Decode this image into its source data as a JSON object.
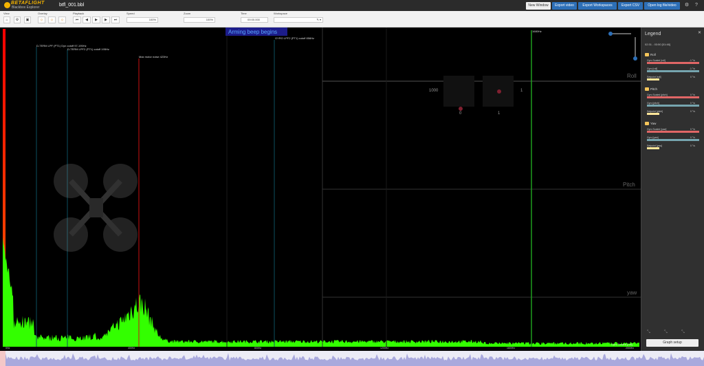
{
  "app": {
    "brand": "BETAFLIGHT",
    "subtitle": "Blackbox Explorer",
    "filename": "btfl_001.bbl"
  },
  "top_buttons": [
    "New Window",
    "Export video",
    "Export Workspaces",
    "Export CSV",
    "Open log file/video"
  ],
  "toolbar": {
    "view_label": "View",
    "overlay_label": "Overlay",
    "playback_label": "Playback",
    "speed_label": "Speed",
    "speed_value": "100%",
    "zoom_label": "Zoom",
    "zoom_value": "100%",
    "time_label": "Time",
    "time_value": "00:00.000",
    "workspace_label": "Workspace"
  },
  "graph": {
    "arming_banner": "Arming beep begins",
    "annotations": [
      "D-TERM LPF (PT1) Dyn cutoff 97-195Hz",
      "D-TERM LPF2 (PT1) cutoff 195Hz",
      "Max motor noise 423Hz",
      "GYRO LPF2 (PT1) cutoff 856Hz",
      "1680Hz"
    ],
    "x_ticks": [
      "0Hz",
      "400Hz",
      "800Hz",
      "1200Hz",
      "1600Hz",
      "2000Hz"
    ],
    "axis_names": [
      "Roll",
      "Pitch",
      "yaw"
    ],
    "stick_labels": [
      "1000",
      "0",
      "1",
      "1"
    ],
    "trace_label": "Gyro Scaled [roll]"
  },
  "legend": {
    "title": "Legend",
    "time_range": "02:31 - 03:50 [01:46]",
    "sections": [
      {
        "title": "Roll",
        "items": [
          {
            "name": "Gyro Scaled [roll]",
            "value": "-1 °/s",
            "color": "#e06666"
          },
          {
            "name": "Gyro [roll]",
            "value": "-1 °/s",
            "color": "#76a5af"
          },
          {
            "name": "Setpoint [roll]",
            "value": "0 °/s",
            "color": "#ffe599"
          }
        ]
      },
      {
        "title": "Pitch",
        "items": [
          {
            "name": "Gyro Scaled [pitch]",
            "value": "0 °/s",
            "color": "#e06666"
          },
          {
            "name": "Gyro [pitch]",
            "value": "0 °/s",
            "color": "#76a5af"
          },
          {
            "name": "Setpoint [pitch]",
            "value": "0 °/s",
            "color": "#ffe599"
          }
        ]
      },
      {
        "title": "Yaw",
        "items": [
          {
            "name": "Gyro Scaled [yaw]",
            "value": "0 °/s",
            "color": "#e06666"
          },
          {
            "name": "Gyro [yaw]",
            "value": "0 °/s",
            "color": "#76a5af"
          },
          {
            "name": "Setpoint [yaw]",
            "value": "0 °/s",
            "color": "#ffe599"
          }
        ]
      }
    ],
    "setup_button": "Graph setup"
  },
  "colors": {
    "accent": "#2d6fb7",
    "spectrum": "#33ff00",
    "brand": "#f5b400"
  }
}
